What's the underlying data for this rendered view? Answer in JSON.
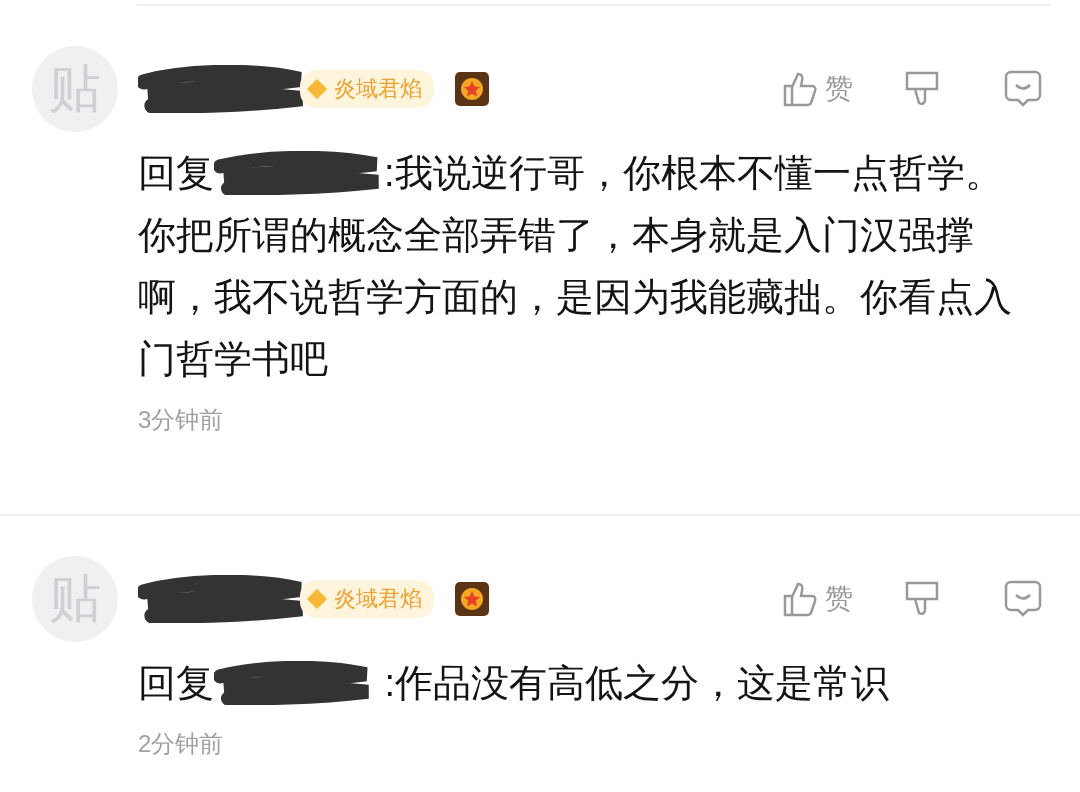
{
  "comments": [
    {
      "avatar_char": "贴",
      "badge": "炎域君焰",
      "like_label": "赞",
      "reply_prefix": "回复",
      "text_lines": [
        ":我说逆行哥，你根本不懂一点哲学。",
        "你把所谓的概念全部弄错了，本身就是入门汉强撑",
        "啊，我不说哲学方面的，是因为我能藏拙。你看点入",
        "门哲学书吧"
      ],
      "time": "3分钟前"
    },
    {
      "avatar_char": "贴",
      "badge": "炎域君焰",
      "like_label": "赞",
      "reply_prefix": "回复",
      "text_lines": [
        " :作品没有高低之分，这是常识"
      ],
      "time": "2分钟前"
    }
  ]
}
